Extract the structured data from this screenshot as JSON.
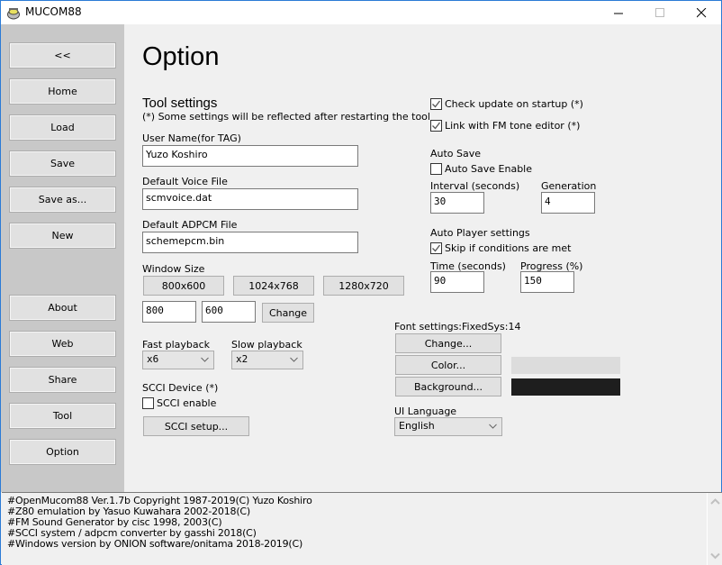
{
  "window": {
    "title": "MUCOM88",
    "controls": {
      "minimize": "minimize",
      "maximize": "maximize",
      "close": "close"
    }
  },
  "sidebar": {
    "items": [
      {
        "label": "<<",
        "name": "collapse"
      },
      {
        "label": "Home",
        "name": "home"
      },
      {
        "label": "Load",
        "name": "load"
      },
      {
        "label": "Save",
        "name": "save"
      },
      {
        "label": "Save as...",
        "name": "save-as"
      },
      {
        "label": "New",
        "name": "new"
      },
      {
        "label": "About",
        "name": "about"
      },
      {
        "label": "Web",
        "name": "web"
      },
      {
        "label": "Share",
        "name": "share"
      },
      {
        "label": "Tool",
        "name": "tool"
      },
      {
        "label": "Option",
        "name": "option"
      }
    ]
  },
  "main": {
    "title": "Option",
    "tool_settings": {
      "title": "Tool settings",
      "note": "(*) Some settings will be reflected after restarting the tool",
      "user_name_label": "User Name(for TAG)",
      "user_name_value": "Yuzo Koshiro",
      "voice_file_label": "Default Voice File",
      "voice_file_value": "scmvoice.dat",
      "adpcm_file_label": "Default ADPCM File",
      "adpcm_file_value": "schemepcm.bin"
    },
    "window_size": {
      "label": "Window Size",
      "presets": [
        "800x600",
        "1024x768",
        "1280x720"
      ],
      "width_value": "800",
      "height_value": "600",
      "change_label": "Change"
    },
    "playback": {
      "fast_label": "Fast playback",
      "fast_value": "x6",
      "slow_label": "Slow playback",
      "slow_value": "x2"
    },
    "scci": {
      "label": "SCCI Device (*)",
      "enable_label": "SCCI enable",
      "enable_checked": false,
      "setup_label": "SCCI setup..."
    },
    "checks": {
      "check_update_label": "Check update on startup (*)",
      "check_update_checked": true,
      "link_fm_label": "Link with FM tone editor (*)",
      "link_fm_checked": true
    },
    "auto_save": {
      "label": "Auto Save",
      "enable_label": "Auto Save Enable",
      "enable_checked": false,
      "interval_label": "Interval (seconds)",
      "interval_value": "30",
      "generation_label": "Generation",
      "generation_value": "4"
    },
    "auto_player": {
      "label": "Auto Player settings",
      "skip_label": "Skip if conditions are met",
      "skip_checked": true,
      "time_label": "Time (seconds)",
      "time_value": "90",
      "progress_label": "Progress (%)",
      "progress_value": "150"
    },
    "font": {
      "label": "Font settings:FixedSys:14",
      "change_label": "Change...",
      "color_label": "Color...",
      "background_label": "Background...",
      "color_swatch": "#dcdcdc",
      "background_swatch": "#1e1e1e"
    },
    "ui_language": {
      "label": "UI Language",
      "value": "English"
    }
  },
  "log": {
    "lines": [
      "#OpenMucom88 Ver.1.7b Copyright 1987-2019(C) Yuzo Koshiro",
      "#Z80 emulation by Yasuo Kuwahara 2002-2018(C)",
      "#FM Sound Generator by cisc 1998, 2003(C)",
      "#SCCI system / adpcm converter by gasshi 2018(C)",
      "#Windows version by ONION software/onitama 2018-2019(C)"
    ]
  }
}
